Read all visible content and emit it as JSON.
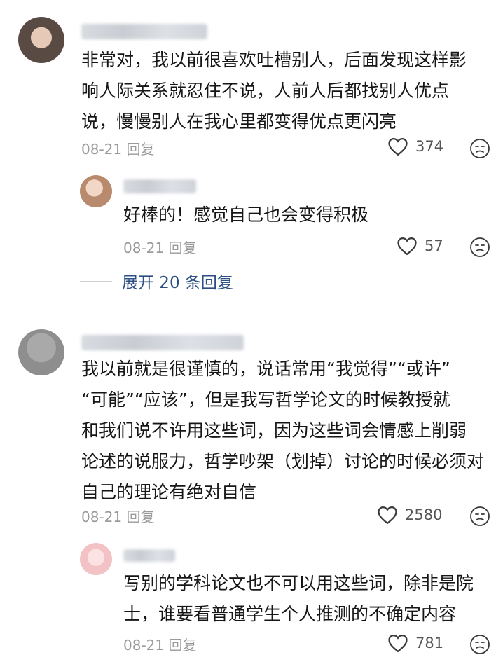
{
  "comments": [
    {
      "text_lines": [
        "非常对，我以前很喜欢吐槽别人，后面发现这样影",
        "响人际关系就忍住不说，人前人后都找别人优点",
        "说，慢慢别人在我心里都变得优点更闪亮"
      ],
      "date": "08-21",
      "reply_label": "回复",
      "likes": "374",
      "reply": {
        "text_lines": [
          "好棒的！感觉自己也会变得积极"
        ],
        "date": "08-21",
        "reply_label": "回复",
        "likes": "57"
      },
      "expand_label": "展开 20 条回复"
    },
    {
      "text_lines": [
        "我以前就是很谨慎的，说话常用“我觉得”“或许”",
        "“可能”“应该”，但是我写哲学论文的时候教授就",
        "和我们说不许用这些词，因为这些词会情感上削弱",
        "论述的说服力，哲学吵架（划掉）讨论的时候必须对",
        "自己的理论有绝对自信"
      ],
      "date": "08-21",
      "reply_label": "回复",
      "likes": "2580",
      "reply": {
        "text_lines": [
          "写别的学科论文也不可以用这些词，除非是院",
          "士，谁要看普通学生个人推测的不确定内容"
        ],
        "date": "08-21",
        "reply_label": "回复",
        "likes": "781"
      }
    }
  ],
  "icons": {
    "like": "heart-outline-icon",
    "dislike": "sad-face-icon"
  },
  "colors": {
    "link": "#2b4f82",
    "meta": "#9a9a9a"
  }
}
